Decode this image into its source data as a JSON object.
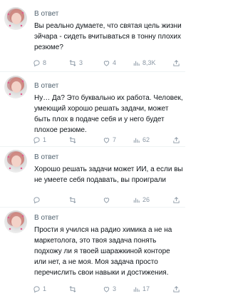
{
  "replies": [
    {
      "reply_to": "В ответ",
      "text": "Вы реально думаете, что святая цель жизни эйчара - сидеть вчитываться в тонну плохих резюме?",
      "stats": {
        "replies": "8",
        "reposts": "3",
        "likes": "4",
        "views": "8,3K"
      }
    },
    {
      "reply_to": "В ответ",
      "text": "Ну… Да? Это буквально их работа. Человек, умеющий хорошо решать задачи, может быть плох в подаче себя и у него будет плохое резюме.",
      "stats": {
        "replies": "1",
        "reposts": "",
        "likes": "7",
        "views": "62"
      }
    },
    {
      "reply_to": "В ответ",
      "text": "Хорошо решать задачи может ИИ, а если вы не умеете себя подавать, вы проиграли",
      "stats": {
        "replies": "",
        "reposts": "",
        "likes": "",
        "views": "26"
      }
    },
    {
      "reply_to": "В ответ",
      "text": "Прости я учился на радио химика а не на маркетолога, это твоя задача понять подхожу ли я твоей шаражкиной конторе или нет, а не моя. Моя задача просто перечислить свои навыки и достижения.",
      "stats": {
        "replies": "1",
        "reposts": "",
        "likes": "3",
        "views": "17"
      }
    }
  ]
}
